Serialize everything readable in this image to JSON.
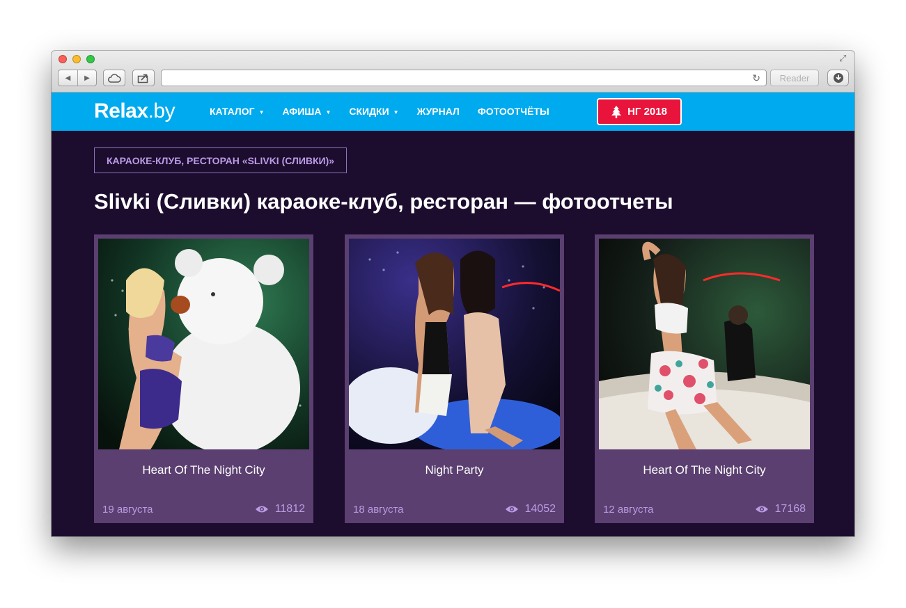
{
  "browser": {
    "reader_label": "Reader",
    "url": ""
  },
  "site": {
    "logo_main": "Relax",
    "logo_domain": ".by",
    "nav": [
      {
        "label": "КАТАЛОГ",
        "has_dropdown": true
      },
      {
        "label": "АФИША",
        "has_dropdown": true
      },
      {
        "label": "СКИДКИ",
        "has_dropdown": true
      },
      {
        "label": "ЖУРНАЛ",
        "has_dropdown": false
      },
      {
        "label": "ФОТООТЧЁТЫ",
        "has_dropdown": false
      }
    ],
    "promo_button": "НГ 2018"
  },
  "main": {
    "place_tag": "КАРАОКЕ-КЛУБ, РЕСТОРАН «SLIVKI (СЛИВКИ)»",
    "page_title": "Slivki (Сливки) караоке-клуб, ресторан — фотоотчеты",
    "cards": [
      {
        "title": "Heart Of The Night City",
        "date": "19 августа",
        "views": "11812"
      },
      {
        "title": "Night Party",
        "date": "18 августа",
        "views": "14052"
      },
      {
        "title": "Heart Of The Night City",
        "date": "12 августа",
        "views": "17168"
      }
    ]
  },
  "colors": {
    "nav_bg": "#00aaee",
    "page_bg": "#1c0c2e",
    "card_bg": "#5b3f70",
    "promo_bg": "#e8143c",
    "meta_text": "#bb9be3"
  },
  "icons": {
    "back": "chevron-left-icon",
    "forward": "chevron-right-icon",
    "cloud": "cloud-icon",
    "share": "share-icon",
    "reload": "reload-icon",
    "download": "download-icon",
    "promo": "christmas-tree-icon",
    "views": "eye-icon"
  }
}
